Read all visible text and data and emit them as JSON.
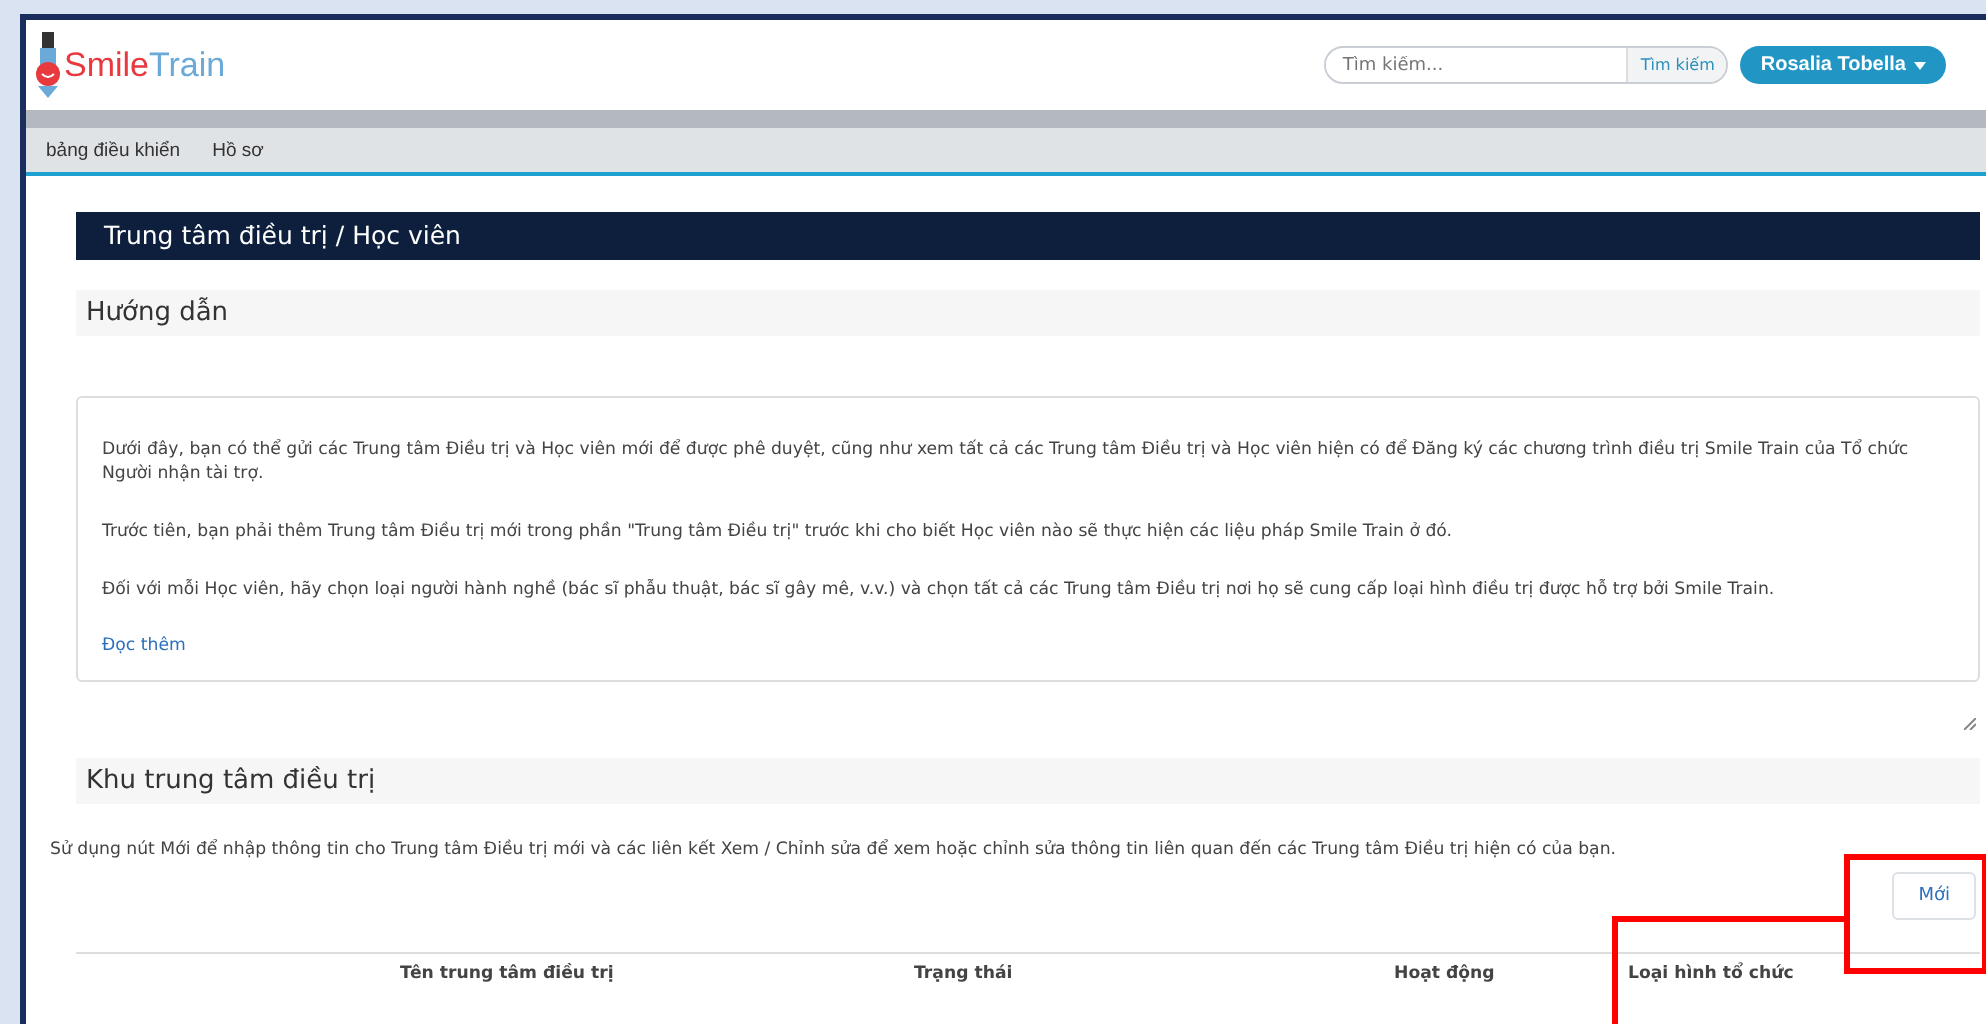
{
  "header": {
    "logo": {
      "brand_bold": "Smile",
      "brand_light": "Train"
    },
    "search": {
      "placeholder": "Tìm kiếm...",
      "button": "Tìm kiếm"
    },
    "user_menu": "Rosalia Tobella"
  },
  "nav": {
    "items": [
      {
        "label": "bảng điều khiển"
      },
      {
        "label": "Hồ sơ"
      }
    ]
  },
  "page_title": "Trung tâm điều trị / Học viên",
  "instructions": {
    "heading": "Hướng dẫn",
    "paragraphs": [
      "Dưới đây, bạn có thể gửi các Trung tâm Điều trị và Học viên mới để được phê duyệt, cũng như xem tất cả các Trung tâm Điều trị và Học viên hiện có để Đăng ký các chương trình điều trị Smile Train của Tổ chức Người nhận tài trợ.",
      "Trước tiên, bạn phải thêm Trung tâm Điều trị mới trong phần \"Trung tâm Điều trị\" trước khi cho biết Học viên nào sẽ thực hiện các liệu pháp Smile Train ở đó.",
      "Đối với mỗi Học viên, hãy chọn loại người hành nghề (bác sĩ phẫu thuật, bác sĩ gây mê, v.v.) và chọn tất cả các Trung tâm Điều trị nơi họ sẽ cung cấp loại hình điều trị được hỗ trợ bởi Smile Train."
    ],
    "read_more": "Đọc thêm"
  },
  "centers": {
    "heading": "Khu trung tâm điều trị",
    "description": "Sử dụng nút Mới để nhập thông tin cho Trung tâm Điều trị mới và các liên kết Xem / Chỉnh sửa để xem hoặc chỉnh sửa thông tin liên quan đến các Trung tâm Điều trị hiện có của bạn.",
    "new_button": "Mới",
    "table": {
      "columns": [
        "Tên trung tâm điều trị",
        "Trạng thái",
        "Hoạt động",
        "Loại hình tổ chức"
      ]
    }
  }
}
